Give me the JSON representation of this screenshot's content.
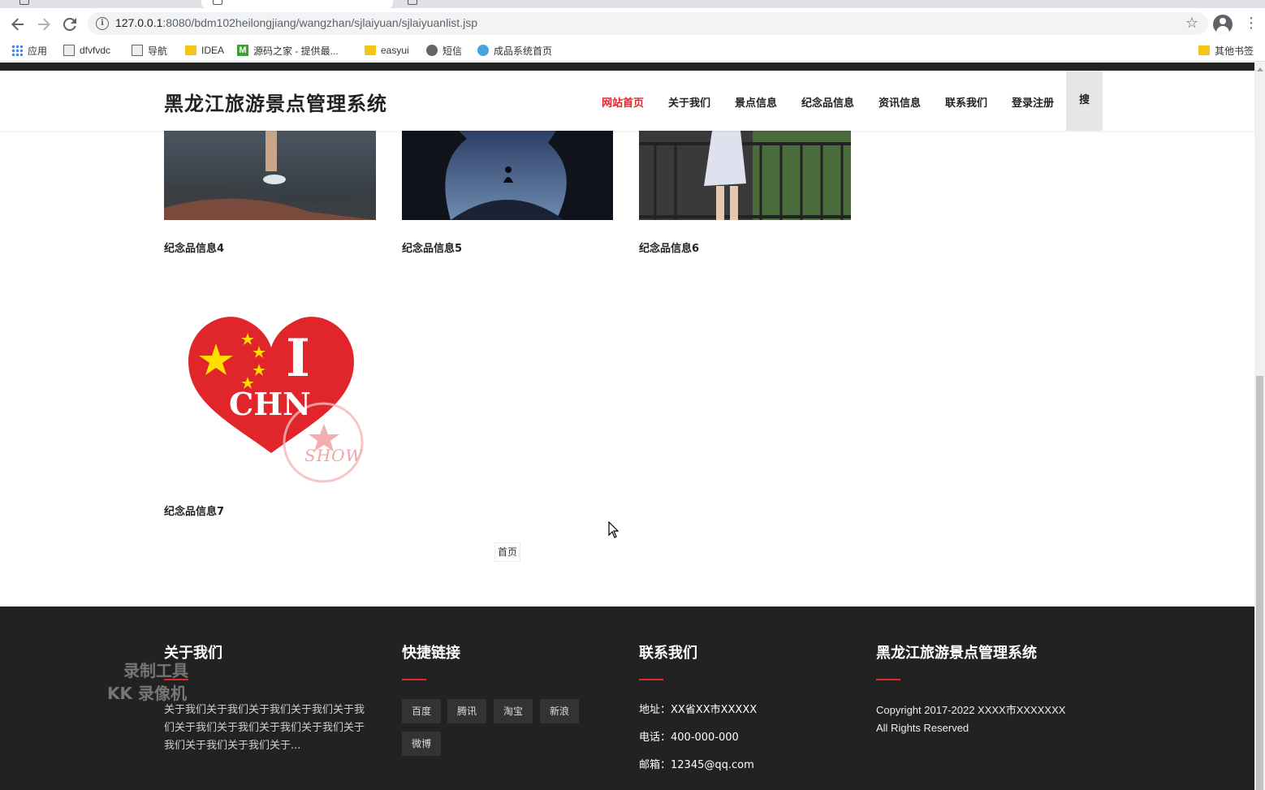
{
  "browser": {
    "url_host": "127.0.0.1",
    "url_path": ":8080/bdm102heilongjiang/wangzhan/sjlaiyuan/sjlaiyuanlist.jsp",
    "bookmarks": [
      {
        "label": "应用",
        "icon": "apps-icon"
      },
      {
        "label": "dfvfvdc",
        "icon": "page-icon"
      },
      {
        "label": "导航",
        "icon": "page-icon"
      },
      {
        "label": "IDEA",
        "icon": "folder-icon"
      },
      {
        "label": "源码之家 - 提供最...",
        "icon": "m-icon"
      },
      {
        "label": "easyui",
        "icon": "folder-icon"
      },
      {
        "label": "短信",
        "icon": "globe-icon"
      },
      {
        "label": "成品系统首页",
        "icon": "blue-circle-icon"
      }
    ],
    "other_bookmarks": "其他书签"
  },
  "header": {
    "site_title": "黑龙江旅游景点管理系统",
    "nav": [
      "网站首页",
      "关于我们",
      "景点信息",
      "纪念品信息",
      "资讯信息",
      "联系我们",
      "登录注册"
    ],
    "active_nav": "网站首页",
    "search_label": "搜"
  },
  "cards": [
    {
      "label": "纪念品信息4"
    },
    {
      "label": "纪念品信息5"
    },
    {
      "label": "纪念品信息6"
    },
    {
      "label": "纪念品信息7"
    }
  ],
  "heart_badge": {
    "big_letter": "I",
    "word": "CHN",
    "stamp_text": "SHOW"
  },
  "pager": {
    "first_label": "首页"
  },
  "footer": {
    "about": {
      "title": "关于我们",
      "text": "关于我们关于我们关于我们关于我们关于我们关于我们关于我们关于我们关于我们关于我们关于我们关于我们关于..."
    },
    "links": {
      "title": "快捷链接",
      "items": [
        "百度",
        "腾讯",
        "淘宝",
        "新浪",
        "微博"
      ]
    },
    "contact": {
      "title": "联系我们",
      "address": "地址：XX省XX市XXXXX",
      "phone": "电话：400-000-000",
      "email": "邮箱：12345@qq.com"
    },
    "brand": {
      "title": "黑龙江旅游景点管理系统",
      "copyright": "Copyright 2017-2022 XXXX市XXXXXXX All Rights Reserved"
    }
  },
  "watermark": {
    "line1": "录制工具",
    "line2": "KK 录像机"
  },
  "colors": {
    "accent": "#e0262b",
    "footer_bg": "#222222",
    "header_bg": "#ffffff"
  }
}
